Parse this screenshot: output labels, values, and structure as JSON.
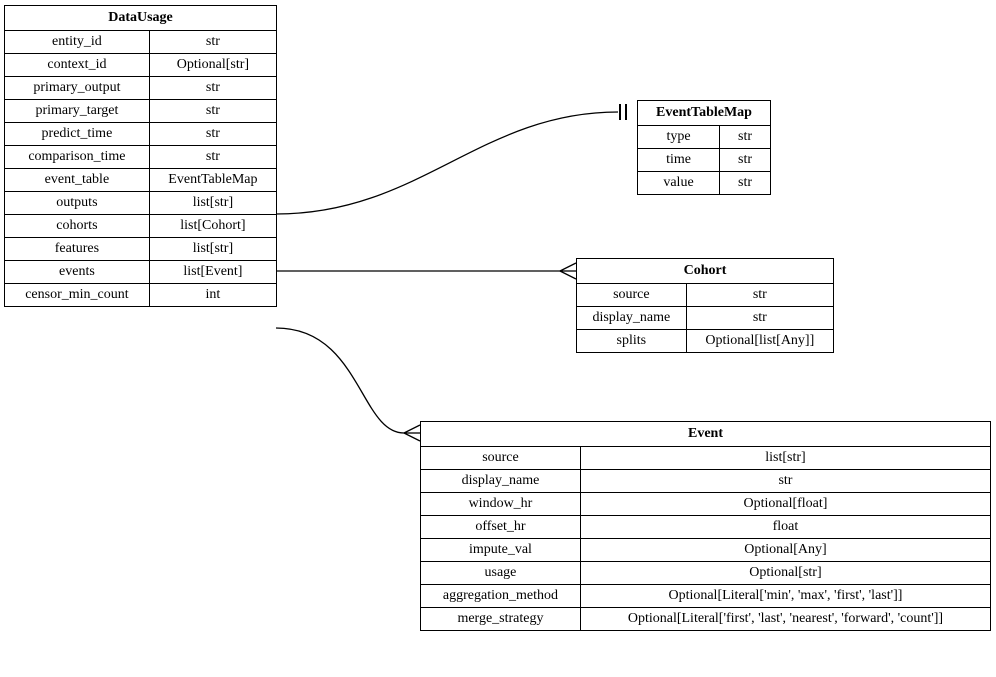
{
  "entities": {
    "dataUsage": {
      "title": "DataUsage",
      "rows": [
        {
          "name": "entity_id",
          "type": "str"
        },
        {
          "name": "context_id",
          "type": "Optional[str]"
        },
        {
          "name": "primary_output",
          "type": "str"
        },
        {
          "name": "primary_target",
          "type": "str"
        },
        {
          "name": "predict_time",
          "type": "str"
        },
        {
          "name": "comparison_time",
          "type": "str"
        },
        {
          "name": "event_table",
          "type": "EventTableMap"
        },
        {
          "name": "outputs",
          "type": "list[str]"
        },
        {
          "name": "cohorts",
          "type": "list[Cohort]"
        },
        {
          "name": "features",
          "type": "list[str]"
        },
        {
          "name": "events",
          "type": "list[Event]"
        },
        {
          "name": "censor_min_count",
          "type": "int"
        }
      ]
    },
    "eventTableMap": {
      "title": "EventTableMap",
      "rows": [
        {
          "name": "type",
          "type": "str"
        },
        {
          "name": "time",
          "type": "str"
        },
        {
          "name": "value",
          "type": "str"
        }
      ]
    },
    "cohort": {
      "title": "Cohort",
      "rows": [
        {
          "name": "source",
          "type": "str"
        },
        {
          "name": "display_name",
          "type": "str"
        },
        {
          "name": "splits",
          "type": "Optional[list[Any]]"
        }
      ]
    },
    "event": {
      "title": "Event",
      "rows": [
        {
          "name": "source",
          "type": "list[str]"
        },
        {
          "name": "display_name",
          "type": "str"
        },
        {
          "name": "window_hr",
          "type": "Optional[float]"
        },
        {
          "name": "offset_hr",
          "type": "float"
        },
        {
          "name": "impute_val",
          "type": "Optional[Any]"
        },
        {
          "name": "usage",
          "type": "Optional[str]"
        },
        {
          "name": "aggregation_method",
          "type": "Optional[Literal['min', 'max', 'first', 'last']]"
        },
        {
          "name": "merge_strategy",
          "type": "Optional[Literal['first', 'last', 'nearest', 'forward', 'count']]"
        }
      ]
    }
  }
}
